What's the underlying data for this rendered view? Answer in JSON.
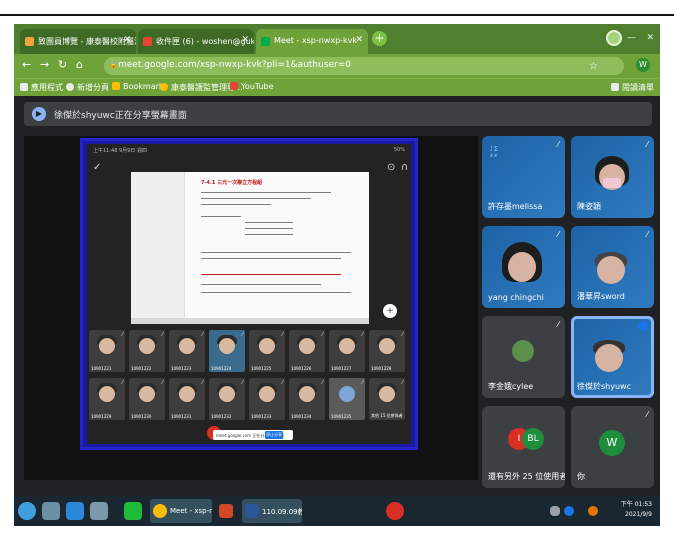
{
  "browser": {
    "tabs": [
      {
        "title": "致團員博覽 - 康泰醫校附屬法人",
        "active": false
      },
      {
        "title": "收件匣 (6) - woshen@gukn.ed",
        "active": false
      },
      {
        "title": "Meet - xsp-nwxp-kvk",
        "active": true
      }
    ],
    "url": "meet.google.com/xsp-nwxp-kvk?pli=1&authuser=0",
    "profile_initial": "W",
    "bookmarks": [
      {
        "label": "應用程式",
        "color": "#e8eaed"
      },
      {
        "label": "新增分頁",
        "color": "#e8eaed"
      },
      {
        "label": "Bookmarks",
        "color": "#fbbc04"
      },
      {
        "label": "康泰醫護監管理專...",
        "color": "#fbbc04"
      },
      {
        "label": "YouTube",
        "color": "#ea4335"
      }
    ],
    "reading_list": "閱讀清單"
  },
  "meet": {
    "presenting_banner": "徐傑於shyuwc正在分享螢幕畫面",
    "shared_screen": {
      "status_left": "上午11:48  9月9日 週四",
      "status_right": "50%",
      "doc_title": "7-4.1 三元一次聯立方程組",
      "share_bar_text": "meet.google.com 正在分享你的畫面",
      "share_bar_button": "停止分享",
      "grid": [
        {
          "tag": "10901221"
        },
        {
          "tag": "10901222"
        },
        {
          "tag": "10901223"
        },
        {
          "tag": "10901224"
        },
        {
          "tag": "10901225"
        },
        {
          "tag": "10901226"
        },
        {
          "tag": "10901227"
        },
        {
          "tag": "10901228"
        },
        {
          "tag": "10901229"
        },
        {
          "tag": "10901230"
        },
        {
          "tag": "10901231"
        },
        {
          "tag": "10901232"
        },
        {
          "tag": "10901233"
        },
        {
          "tag": "10901234"
        },
        {
          "tag": "10901235"
        },
        {
          "tag": "其他 15 位參與者"
        }
      ]
    },
    "participants": [
      {
        "name": "許存墨melissa"
      },
      {
        "name": "陳姿穎"
      },
      {
        "name": "yang chingchi"
      },
      {
        "name": "潘華昇sword"
      },
      {
        "name": "李金娥cylee"
      },
      {
        "name": "徐傑於shyuwc"
      },
      {
        "name": "還有另外 25 位使用者",
        "initials": [
          "I",
          "BL"
        ]
      },
      {
        "name": "你",
        "initials": [
          "W"
        ]
      }
    ]
  },
  "taskbar": {
    "windows": [
      {
        "label": "Meet - xsp-n..."
      },
      {
        "label": ""
      },
      {
        "label": "110.09.09教..."
      }
    ],
    "time": "下午 01:53",
    "date": "2021/9/9"
  }
}
